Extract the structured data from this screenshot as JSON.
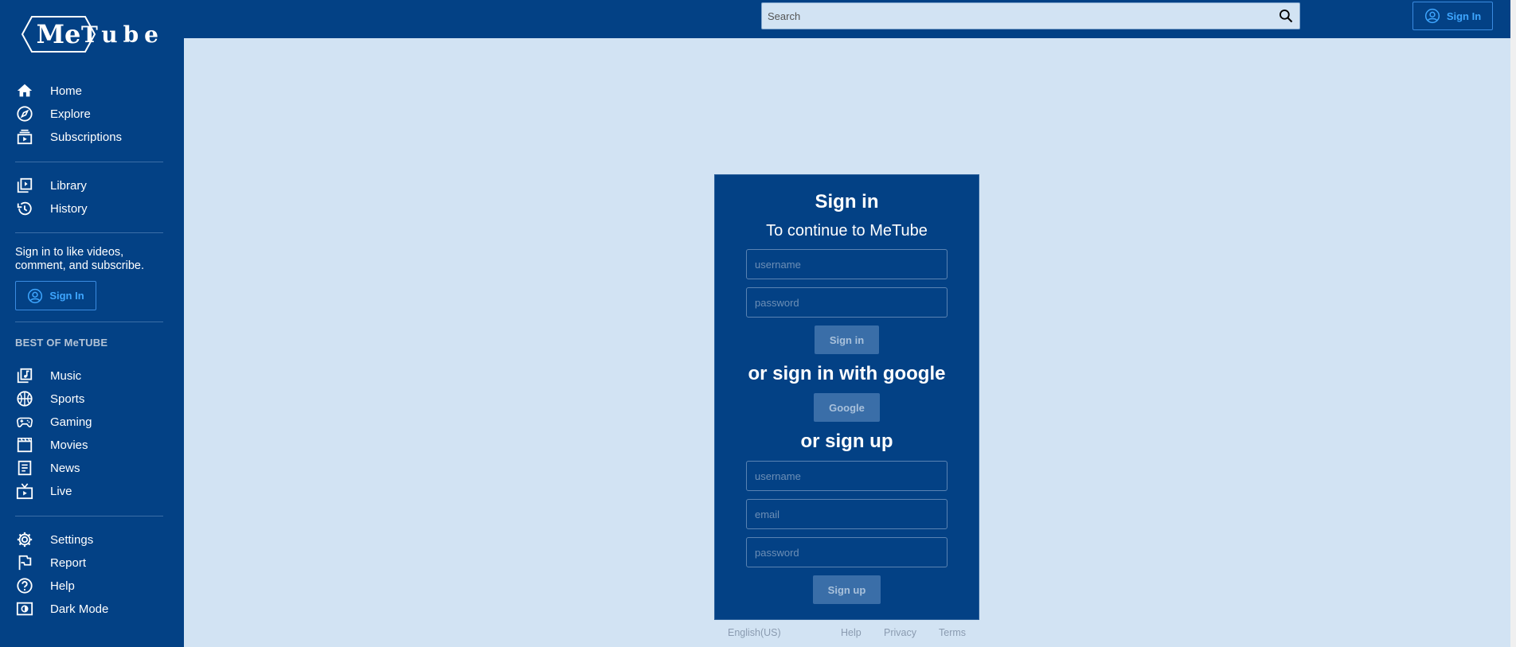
{
  "app": {
    "logo_me": "Me",
    "logo_tube": "Tube"
  },
  "search": {
    "placeholder": "Search"
  },
  "header": {
    "signin_label": "Sign In"
  },
  "sidebar": {
    "primary": [
      {
        "label": "Home",
        "icon": "home-icon"
      },
      {
        "label": "Explore",
        "icon": "compass-icon"
      },
      {
        "label": "Subscriptions",
        "icon": "subscriptions-icon"
      }
    ],
    "library": [
      {
        "label": "Library",
        "icon": "library-icon"
      },
      {
        "label": "History",
        "icon": "history-icon"
      }
    ],
    "signin_prompt": "Sign in to like videos, comment, and subscribe.",
    "signin_label": "Sign In",
    "best_title": "BEST OF MeTUBE",
    "best": [
      {
        "label": "Music",
        "icon": "music-icon"
      },
      {
        "label": "Sports",
        "icon": "sports-icon"
      },
      {
        "label": "Gaming",
        "icon": "gaming-icon"
      },
      {
        "label": "Movies",
        "icon": "movies-icon"
      },
      {
        "label": "News",
        "icon": "news-icon"
      },
      {
        "label": "Live",
        "icon": "live-icon"
      }
    ],
    "more": [
      {
        "label": "Settings",
        "icon": "gear-icon"
      },
      {
        "label": "Report",
        "icon": "flag-icon"
      },
      {
        "label": "Help",
        "icon": "help-icon"
      },
      {
        "label": "Dark Mode",
        "icon": "dark-mode-icon"
      }
    ]
  },
  "card": {
    "title": "Sign in",
    "subtitle": "To continue to MeTube",
    "signin_username_placeholder": "username",
    "signin_password_placeholder": "password",
    "signin_button": "Sign in",
    "google_heading": "or sign in with google",
    "google_button": "Google",
    "signup_heading": "or sign up",
    "signup_username_placeholder": "username",
    "signup_email_placeholder": "email",
    "signup_password_placeholder": "password",
    "signup_button": "Sign up"
  },
  "footer": {
    "language": "English(US)",
    "help": "Help",
    "privacy": "Privacy",
    "terms": "Terms"
  },
  "colors": {
    "primary": "#034185",
    "background": "#d2e3f3",
    "accent": "#3ea6ff"
  }
}
